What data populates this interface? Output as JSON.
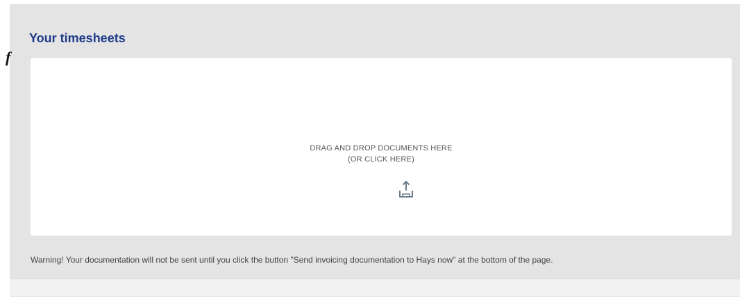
{
  "section": {
    "title": "Your timesheets"
  },
  "stray_mark": "f",
  "dropzone": {
    "line1": "DRAG AND DROP DOCUMENTS HERE",
    "line2": "(OR CLICK HERE)",
    "icon": "upload-icon"
  },
  "warning": "Warning! Your documentation will not be sent until you click the button \"Send invoicing documentation to Hays now\" at the bottom of the page.",
  "colors": {
    "title": "#1f3a8a",
    "panel_bg": "#e4e4e4",
    "dropzone_bg": "#ffffff"
  }
}
